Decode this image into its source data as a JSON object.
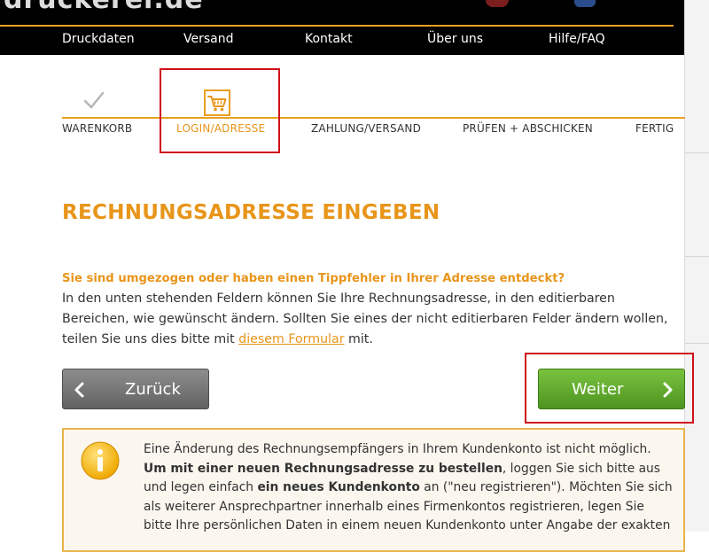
{
  "header": {
    "logo_text": "druckerei.de",
    "nav": [
      "Druckdaten",
      "Versand",
      "Kontakt",
      "Über uns",
      "Hilfe/FAQ"
    ]
  },
  "stepper": {
    "steps": [
      "WARENKORB",
      "LOGIN/ADRESSE",
      "ZAHLUNG/VERSAND",
      "PRÜFEN + ABSCHICKEN",
      "FERTIG"
    ],
    "active": "LOGIN/ADRESSE",
    "icons": [
      "check-icon",
      "cart-icon"
    ]
  },
  "main": {
    "title": "RECHNUNGSADRESSE EINGEBEN",
    "question": "Sie sind umgezogen oder haben einen Tippfehler in Ihrer Adresse entdeckt?",
    "text_before_link": "In den unten stehenden Feldern können Sie Ihre Rechnungsadresse, in den editierbaren Bereichen, wie gewünscht ändern. Sollten Sie eines der nicht editierbaren Felder ändern wollen, teilen Sie uns dies bitte mit ",
    "link_text": "diesem Formular",
    "text_after_link": " mit."
  },
  "buttons": {
    "back_label": "Zurück",
    "next_label": "Weiter"
  },
  "info": {
    "part1": "Eine Änderung des Rechnungsempfängers in Ihrem Kundenkonto ist nicht möglich.",
    "bold1": "Um mit einer neuen Rechnungsadresse zu bestellen",
    "part2": ", loggen Sie sich bitte aus und legen einfach ",
    "bold2": "ein neues Kundenkonto",
    "part3": " an (\"neu registrieren\"). Möchten Sie sich als weiterer Ansprechpartner innerhalb eines Firmenkontos registrieren, legen Sie bitte Ihre persönlichen Daten in einem neuen Kundenkonto unter Angabe der exakten"
  },
  "colors": {
    "accent": "#e8951a",
    "highlight": "#d0101a",
    "next_button": "#5aa52a",
    "back_button": "#757575",
    "header_bg": "#000000"
  }
}
